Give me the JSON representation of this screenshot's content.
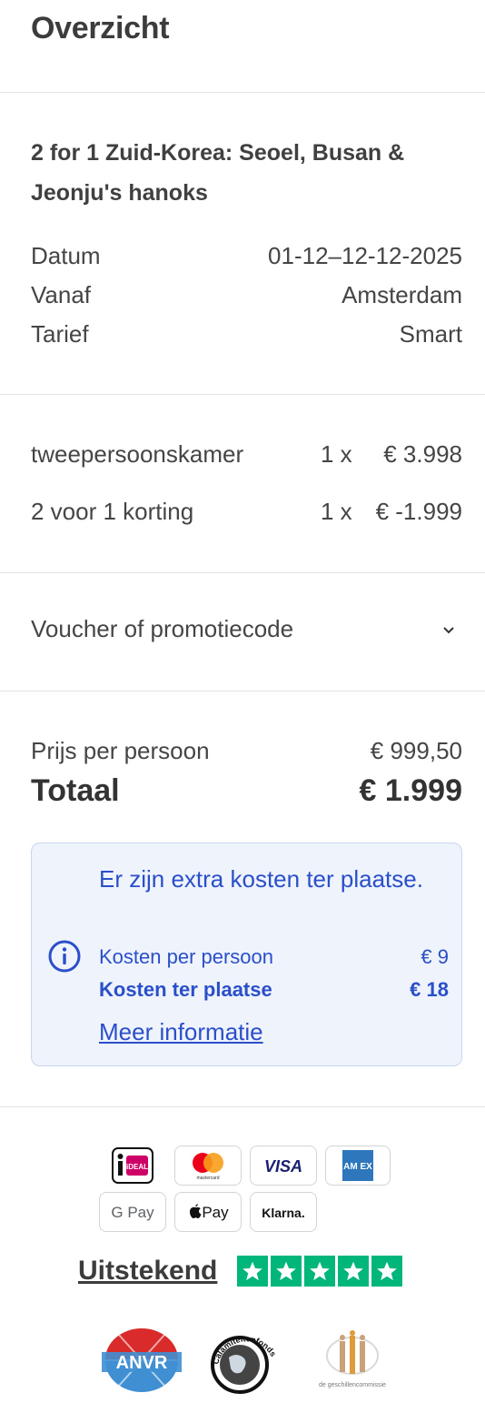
{
  "header": {
    "title": "Overzicht"
  },
  "trip": {
    "title": "2 for 1 Zuid-Korea: Seoel, Busan & Jeonju's hanoks",
    "details": [
      {
        "label": "Datum",
        "value": "01-12–12-12-2025"
      },
      {
        "label": "Vanaf",
        "value": "Amsterdam"
      },
      {
        "label": "Tarief",
        "value": "Smart"
      }
    ]
  },
  "line_items": [
    {
      "name": "tweepersoonskamer",
      "qty": "1 x",
      "amount": "€ 3.998"
    },
    {
      "name": "2 voor 1 korting",
      "qty": "1 x",
      "amount": "€ -1.999"
    }
  ],
  "voucher": {
    "label": "Voucher of promotiecode",
    "icon": "chevron-down-icon"
  },
  "pricing": {
    "per_person_label": "Prijs per persoon",
    "per_person_value": "€ 999,50",
    "total_label": "Totaal",
    "total_value": "€ 1.999"
  },
  "extra_costs": {
    "heading": "Er zijn extra kosten ter plaatse.",
    "rows": [
      {
        "label": "Kosten per persoon",
        "value": "€ 9"
      },
      {
        "label": "Kosten ter plaatse",
        "value": "€ 18"
      }
    ],
    "link": "Meer informatie",
    "icon": "info-icon",
    "color": "#2a4fc9"
  },
  "payment_methods": {
    "ideal": "iDEAL",
    "mastercard": "mastercard",
    "visa": "VISA",
    "amex": "AM EX",
    "googlepay": "G Pay",
    "applepay": "Pay",
    "klarna": "Klarna."
  },
  "trustpilot": {
    "label": "Uitstekend",
    "stars": 5,
    "color": "#00b67a"
  },
  "logos": {
    "anvr": "ANVR",
    "calamiteitenfonds": "Calamiteitenfonds",
    "geschillencommissie": "de geschillencommissie"
  }
}
